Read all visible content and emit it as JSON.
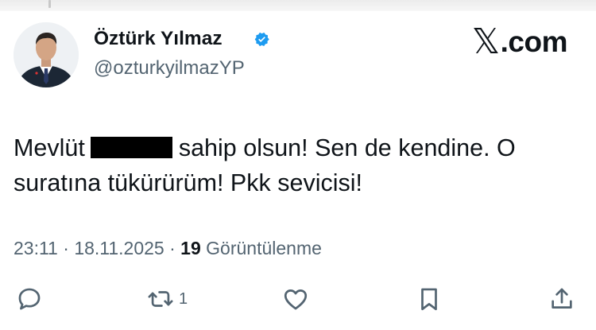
{
  "header": {
    "name": "Öztürk Yılmaz",
    "handle": "@ozturkyilmazYP",
    "brand": ".com",
    "brand_icon": "x-logo-icon",
    "verified_color": "#1d9bf0"
  },
  "tweet": {
    "line1_start": "Mevlüt",
    "line1_end": "sahip olsun! Sen de kendine. O",
    "line2": "suratına tükürürüm! Pkk sevicisi!"
  },
  "meta": {
    "time": "23:11",
    "date": "18.11.2025",
    "separator": "·",
    "views_count": "19",
    "views_label": "Görüntülenme"
  },
  "actions": {
    "reply_icon": "reply-icon",
    "retweet_icon": "retweet-icon",
    "retweet_count": "1",
    "like_icon": "heart-icon",
    "bookmark_icon": "bookmark-icon",
    "share_icon": "share-icon"
  }
}
